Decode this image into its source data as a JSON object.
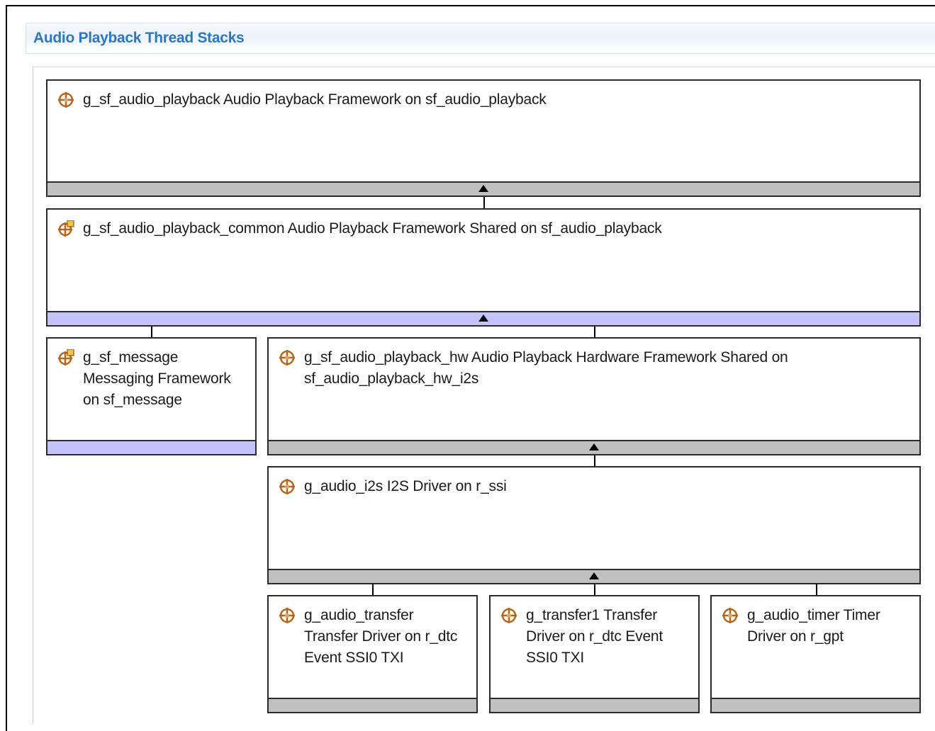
{
  "section": {
    "title": "Audio Playback Thread Stacks"
  },
  "modules": [
    {
      "id": "playback",
      "label": "g_sf_audio_playback Audio Playback Framework on sf_audio_playback",
      "icon": "module-icon",
      "bar": "gray"
    },
    {
      "id": "common",
      "label": "g_sf_audio_playback_common Audio Playback Framework Shared on sf_audio_playback",
      "icon": "shared-module-icon",
      "bar": "blue"
    },
    {
      "id": "message",
      "label": "g_sf_message Messaging Framework on sf_message",
      "icon": "shared-module-icon",
      "bar": "blue"
    },
    {
      "id": "hw",
      "label": "g_sf_audio_playback_hw Audio Playback Hardware Framework Shared on sf_audio_playback_hw_i2s",
      "icon": "module-icon",
      "bar": "gray"
    },
    {
      "id": "i2s",
      "label": "g_audio_i2s I2S Driver on r_ssi",
      "icon": "module-icon",
      "bar": "gray"
    },
    {
      "id": "transfer",
      "label": "g_audio_transfer Transfer Driver on r_dtc Event SSI0 TXI",
      "icon": "module-icon",
      "bar": "gray"
    },
    {
      "id": "transfer1",
      "label": "g_transfer1 Transfer Driver on r_dtc Event SSI0 TXI",
      "icon": "module-icon",
      "bar": "gray"
    },
    {
      "id": "timer",
      "label": "g_audio_timer Timer Driver on r_gpt",
      "icon": "module-icon",
      "bar": "gray"
    }
  ],
  "colors": {
    "title": "#2b78c2",
    "bar_gray": "#c0c0c0",
    "bar_blue": "#c4c4fb",
    "icon": "#b5651d"
  }
}
